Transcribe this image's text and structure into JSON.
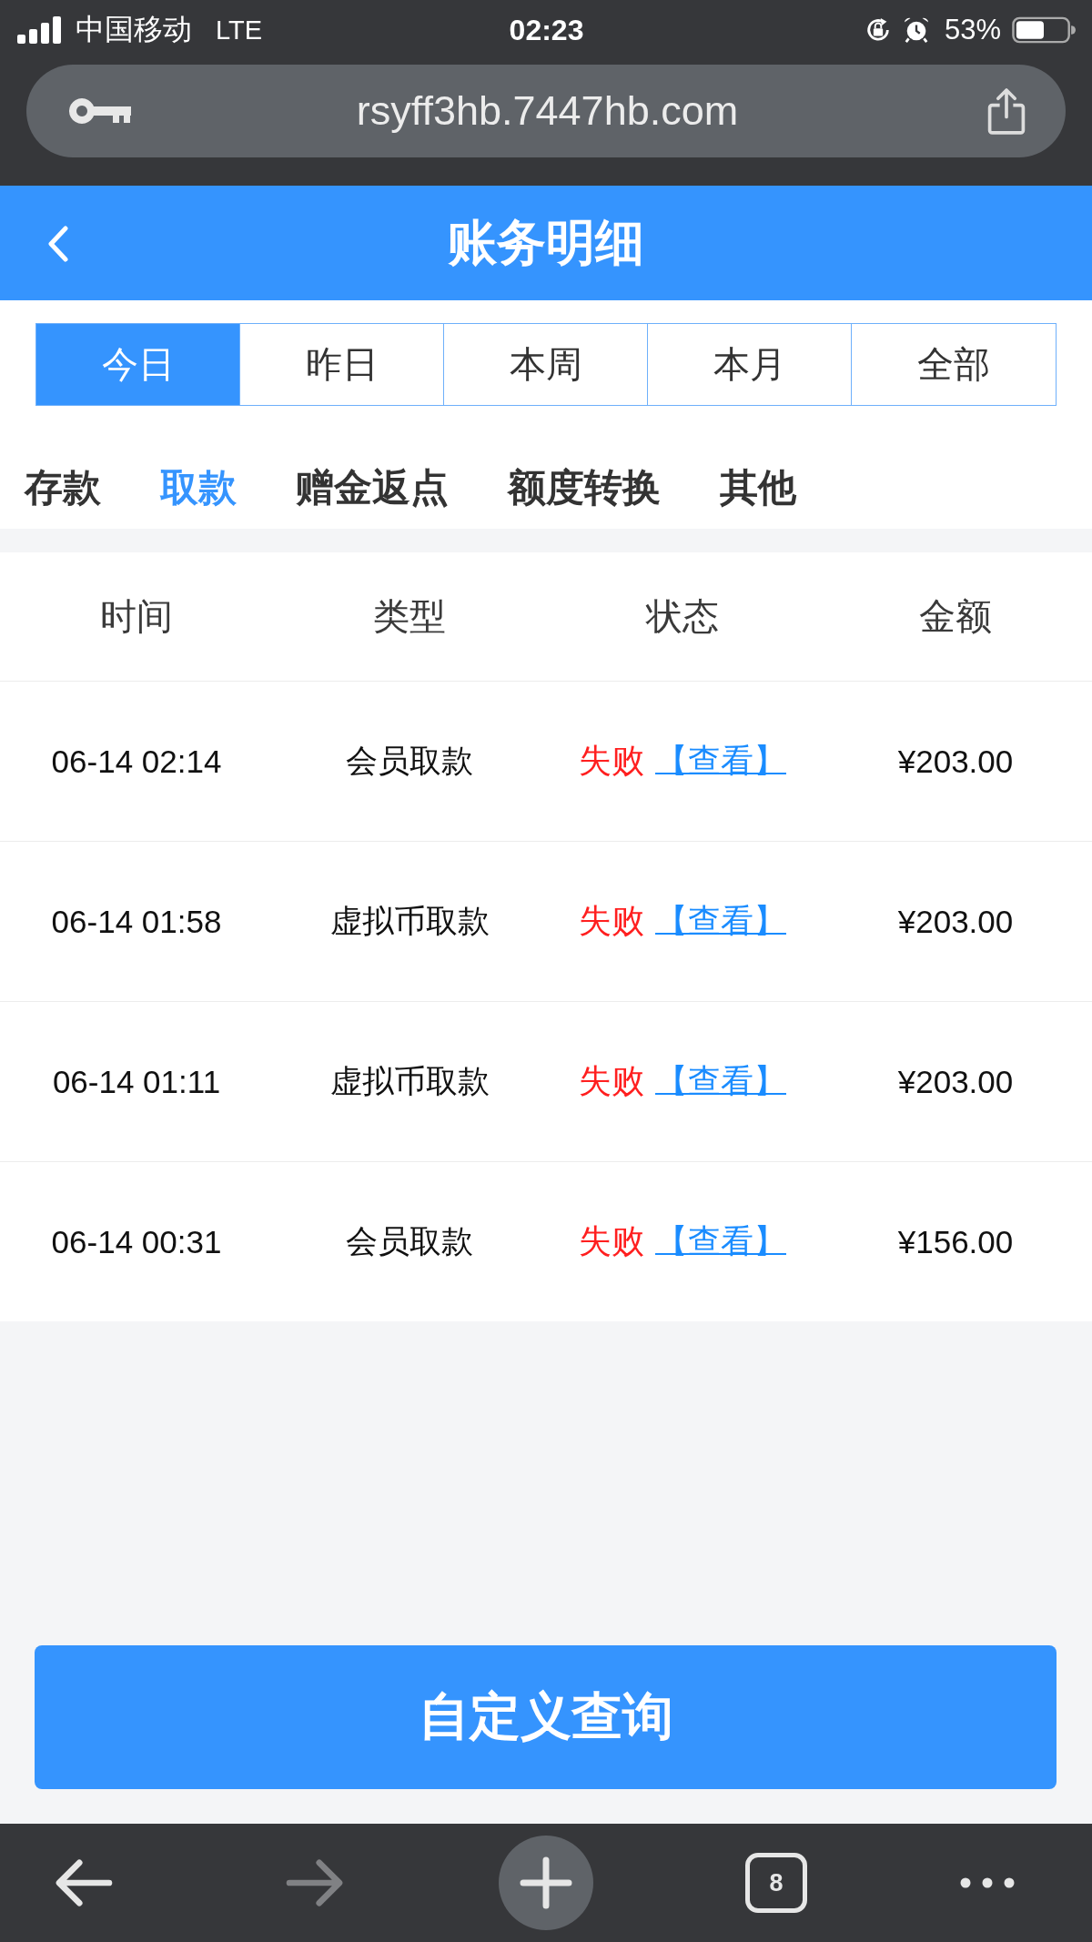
{
  "status_bar": {
    "carrier": "中国移动",
    "network": "LTE",
    "time": "02:23",
    "battery": "53%"
  },
  "address_bar": {
    "url": "rsyff3hb.7447hb.com"
  },
  "header": {
    "title": "账务明细"
  },
  "period_tabs": [
    {
      "label": "今日",
      "selected": true
    },
    {
      "label": "昨日",
      "selected": false
    },
    {
      "label": "本周",
      "selected": false
    },
    {
      "label": "本月",
      "selected": false
    },
    {
      "label": "全部",
      "selected": false
    }
  ],
  "category_tabs": [
    {
      "label": "存款",
      "selected": false
    },
    {
      "label": "取款",
      "selected": true
    },
    {
      "label": "赠金返点",
      "selected": false
    },
    {
      "label": "额度转换",
      "selected": false
    },
    {
      "label": "其他",
      "selected": false
    }
  ],
  "table": {
    "columns": [
      "时间",
      "类型",
      "状态",
      "金额"
    ],
    "rows": [
      {
        "time": "06-14 02:14",
        "type": "会员取款",
        "status": "失败",
        "failed": true,
        "link": "【查看】",
        "amount": "¥203.00"
      },
      {
        "time": "06-14 01:58",
        "type": "虚拟币取款",
        "status": "失败",
        "failed": true,
        "link": "【查看】",
        "amount": "¥203.00"
      },
      {
        "time": "06-14 01:11",
        "type": "虚拟币取款",
        "status": "失败",
        "failed": true,
        "link": "【查看】",
        "amount": "¥203.00"
      },
      {
        "time": "06-14 00:31",
        "type": "会员取款",
        "status": "失败",
        "failed": true,
        "link": "【查看】",
        "amount": "¥156.00"
      }
    ]
  },
  "query_button": {
    "label": "自定义查询"
  },
  "toolbar": {
    "back": {
      "disabled": false
    },
    "forward": {
      "disabled": true
    },
    "tab_count": "8"
  }
}
